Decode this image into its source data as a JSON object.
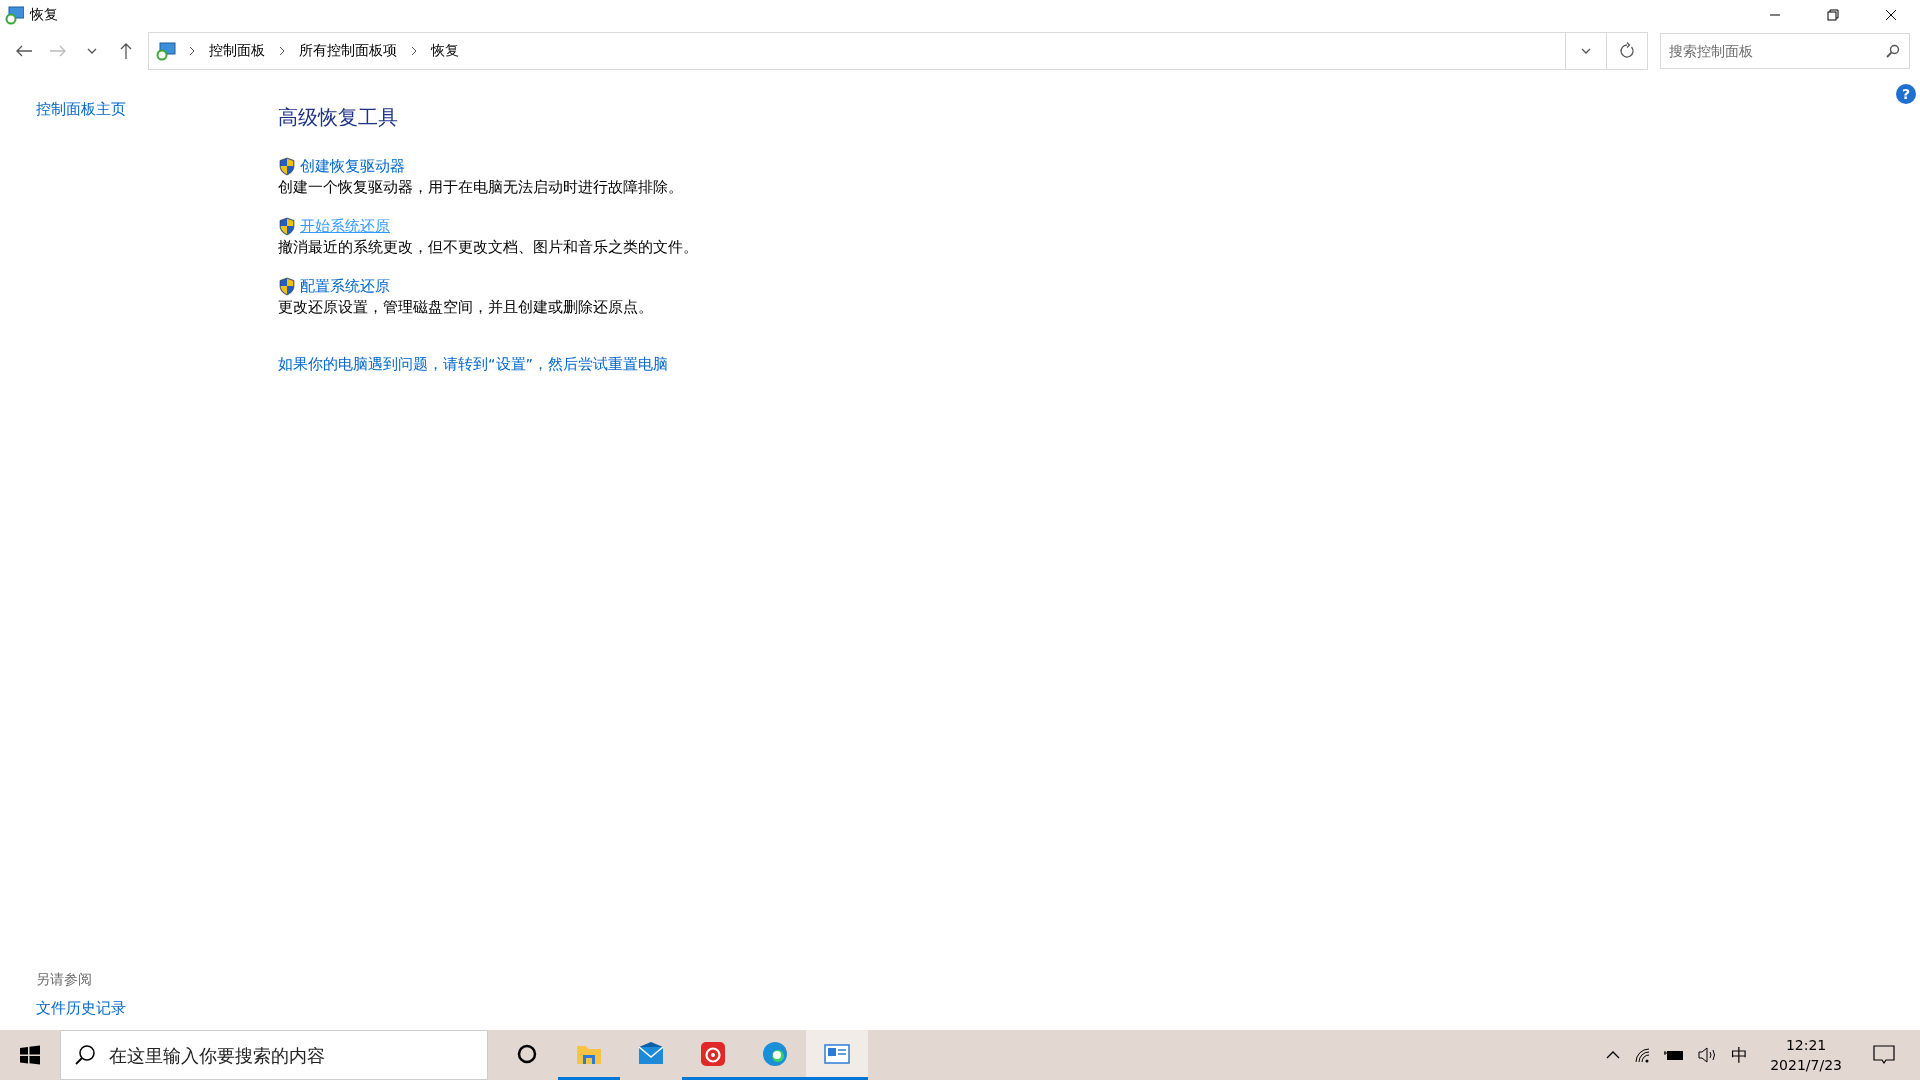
{
  "window": {
    "title": "恢复"
  },
  "address_bar": {
    "crumbs": [
      "控制面板",
      "所有控制面板项",
      "恢复"
    ]
  },
  "search": {
    "placeholder": "搜索控制面板"
  },
  "help_button": "?",
  "sidebar": {
    "home_link": "控制面板主页",
    "see_also_heading": "另请参阅",
    "see_also_links": [
      "文件历史记录"
    ]
  },
  "content": {
    "heading": "高级恢复工具",
    "tasks": [
      {
        "link": "创建恢复驱动器",
        "description": "创建一个恢复驱动器，用于在电脑无法启动时进行故障排除。",
        "hovered": false
      },
      {
        "link": "开始系统还原",
        "description": "撤消最近的系统更改，但不更改文档、图片和音乐之类的文件。",
        "hovered": true
      },
      {
        "link": "配置系统还原",
        "description": "更改还原设置，管理磁盘空间，并且创建或删除还原点。",
        "hovered": false
      }
    ],
    "reset_link": "如果你的电脑遇到问题，请转到“设置”，然后尝试重置电脑"
  },
  "taskbar": {
    "search_placeholder": "在这里输入你要搜索的内容",
    "apps": [
      {
        "kind": "cortana",
        "running": false,
        "selected": false
      },
      {
        "kind": "explorer",
        "running": true,
        "selected": false
      },
      {
        "kind": "mail",
        "running": false,
        "selected": false
      },
      {
        "kind": "music",
        "running": true,
        "selected": false
      },
      {
        "kind": "edge",
        "running": true,
        "selected": false
      },
      {
        "kind": "controlpanel",
        "running": true,
        "selected": true
      }
    ],
    "ime": "中",
    "time": "12:21",
    "date": "2021/7/23"
  }
}
